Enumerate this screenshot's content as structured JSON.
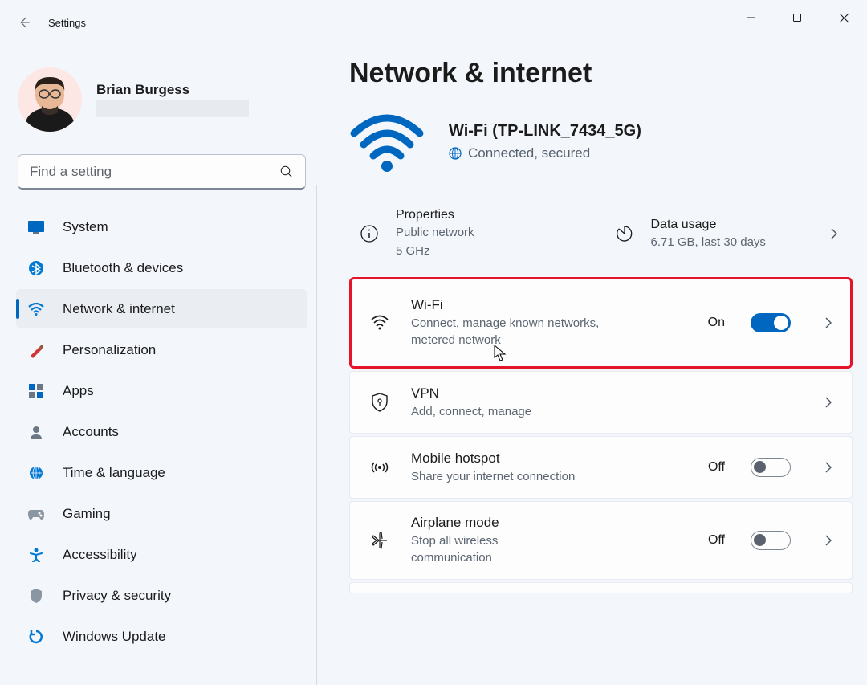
{
  "title": "Settings",
  "user": {
    "name": "Brian Burgess"
  },
  "search": {
    "placeholder": "Find a setting"
  },
  "nav": [
    {
      "id": "system",
      "label": "System"
    },
    {
      "id": "bluetooth",
      "label": "Bluetooth & devices"
    },
    {
      "id": "network",
      "label": "Network & internet"
    },
    {
      "id": "personalization",
      "label": "Personalization"
    },
    {
      "id": "apps",
      "label": "Apps"
    },
    {
      "id": "accounts",
      "label": "Accounts"
    },
    {
      "id": "time",
      "label": "Time & language"
    },
    {
      "id": "gaming",
      "label": "Gaming"
    },
    {
      "id": "accessibility",
      "label": "Accessibility"
    },
    {
      "id": "privacy",
      "label": "Privacy & security"
    },
    {
      "id": "update",
      "label": "Windows Update"
    }
  ],
  "page": {
    "title": "Network & internet",
    "status": {
      "ssid": "Wi-Fi (TP-LINK_7434_5G)",
      "state": "Connected, secured"
    },
    "info": {
      "properties": {
        "title": "Properties",
        "line1": "Public network",
        "line2": "5 GHz"
      },
      "usage": {
        "title": "Data usage",
        "line1": "6.71 GB, last 30 days"
      }
    },
    "settings": [
      {
        "id": "wifi",
        "title": "Wi-Fi",
        "sub": "Connect, manage known networks, metered network",
        "state": "On",
        "toggle": "on",
        "highlight": true
      },
      {
        "id": "vpn",
        "title": "VPN",
        "sub": "Add, connect, manage"
      },
      {
        "id": "hotspot",
        "title": "Mobile hotspot",
        "sub": "Share your internet connection",
        "state": "Off",
        "toggle": "off"
      },
      {
        "id": "airplane",
        "title": "Airplane mode",
        "sub": "Stop all wireless communication",
        "state": "Off",
        "toggle": "off"
      }
    ]
  }
}
